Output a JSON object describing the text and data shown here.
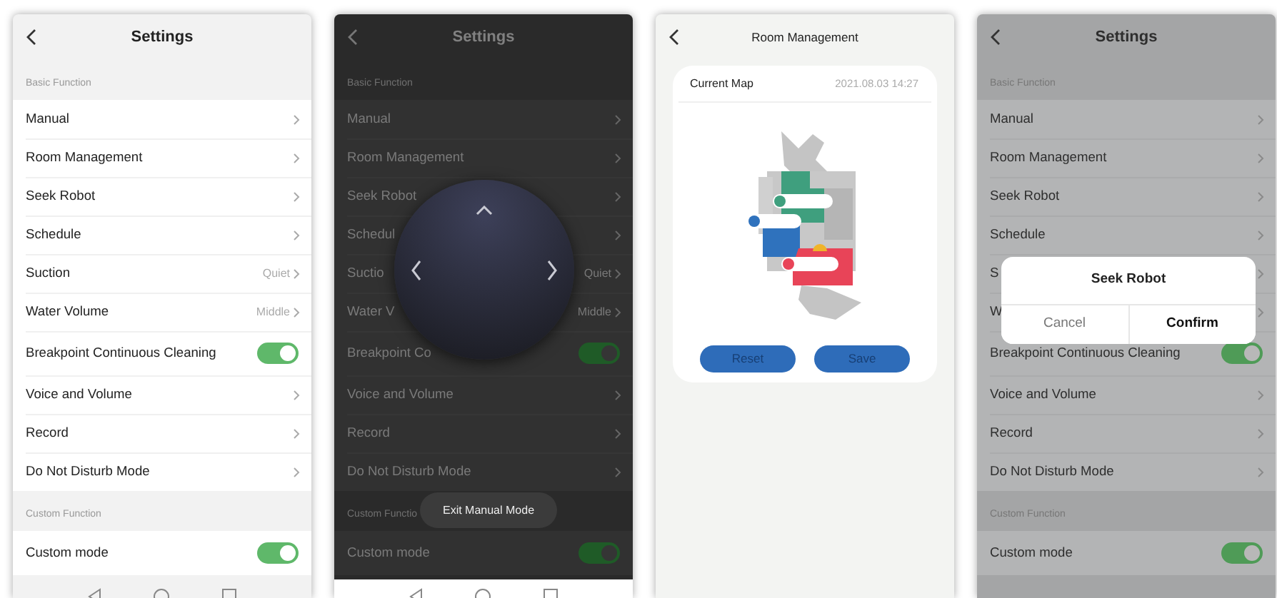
{
  "screens": [
    {
      "kind": "settings",
      "title": "Settings",
      "nav_bar": true,
      "sections": [
        {
          "label": "Basic Function",
          "items": [
            {
              "kind": "link",
              "label": "Manual"
            },
            {
              "kind": "link",
              "label": "Room Management"
            },
            {
              "kind": "link",
              "label": "Seek Robot"
            },
            {
              "kind": "link",
              "label": "Schedule"
            },
            {
              "kind": "link",
              "label": "Suction",
              "value": "Quiet"
            },
            {
              "kind": "link",
              "label": "Water Volume",
              "value": "Middle"
            },
            {
              "kind": "toggle",
              "label": "Breakpoint Continuous Cleaning",
              "on": true
            },
            {
              "kind": "link",
              "label": "Voice and Volume"
            },
            {
              "kind": "link",
              "label": "Record"
            },
            {
              "kind": "link",
              "label": "Do Not Disturb Mode"
            }
          ]
        },
        {
          "label": "Custom Function",
          "items": [
            {
              "kind": "toggle",
              "label": "Custom mode",
              "on": true
            }
          ]
        }
      ]
    },
    {
      "kind": "settings",
      "title": "Settings",
      "dimmed": true,
      "nav_bar": true,
      "sections": [
        {
          "label": "Basic Function",
          "items": [
            {
              "kind": "link",
              "label": "Manual"
            },
            {
              "kind": "link",
              "label": "Room Management"
            },
            {
              "kind": "link",
              "label": "Seek Robot"
            },
            {
              "kind": "link",
              "label": "Schedul"
            },
            {
              "kind": "link",
              "label": "Suctio",
              "value": "Quiet"
            },
            {
              "kind": "link",
              "label": "Water V",
              "value": "Middle"
            },
            {
              "kind": "toggle",
              "label": "Breakpoint Co",
              "on": true
            },
            {
              "kind": "link",
              "label": "Voice and Volume"
            },
            {
              "kind": "link",
              "label": "Record"
            },
            {
              "kind": "link",
              "label": "Do Not Disturb Mode"
            }
          ]
        },
        {
          "label": "Custom Functio",
          "items": [
            {
              "kind": "toggle",
              "label": "Custom mode",
              "on": true
            }
          ]
        }
      ],
      "overlay": {
        "kind": "joystick",
        "button": "Exit Manual Mode"
      }
    },
    {
      "kind": "room_management",
      "title": "Room Management",
      "card": {
        "title": "Current Map",
        "timestamp": "2021.08.03 14:27",
        "buttons": [
          "Reset",
          "Save"
        ]
      }
    },
    {
      "kind": "settings",
      "title": "Settings",
      "dimmed": true,
      "sections": [
        {
          "label": "Basic Function",
          "items": [
            {
              "kind": "link",
              "label": "Manual"
            },
            {
              "kind": "link",
              "label": "Room Management"
            },
            {
              "kind": "link",
              "label": "Seek Robot"
            },
            {
              "kind": "link",
              "label": "Schedule"
            },
            {
              "kind": "link",
              "label": "S"
            },
            {
              "kind": "link",
              "label": "W"
            },
            {
              "kind": "toggle",
              "label": "Breakpoint Continuous Cleaning",
              "on": true
            },
            {
              "kind": "link",
              "label": "Voice and Volume"
            },
            {
              "kind": "link",
              "label": "Record"
            },
            {
              "kind": "link",
              "label": "Do Not Disturb Mode"
            }
          ]
        },
        {
          "label": "Custom Function",
          "items": [
            {
              "kind": "toggle",
              "label": "Custom mode",
              "on": true
            }
          ]
        }
      ],
      "overlay": {
        "kind": "dialog",
        "title": "Seek Robot",
        "buttons": [
          "Cancel",
          "Confirm"
        ]
      }
    }
  ]
}
